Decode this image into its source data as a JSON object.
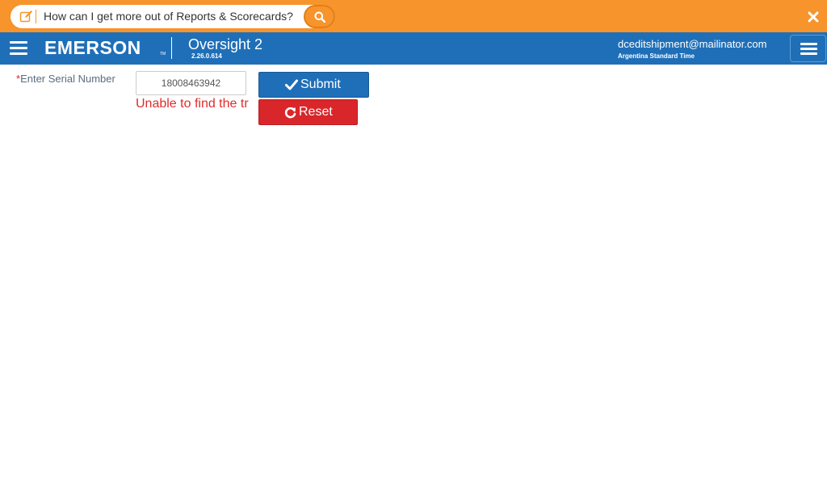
{
  "help_bar": {
    "search_text": "How can I get more out of Reports & Scorecards?",
    "accent_color": "#f7942b",
    "icons": [
      "edit-icon",
      "search-icon",
      "close-icon"
    ]
  },
  "navbar": {
    "brand": "EMERSON",
    "brand_mark": "TM",
    "app_title": "Oversight 2",
    "app_version": "2.26.0.614",
    "user_email": "dceditshipment@mailinator.com",
    "user_timezone": "Argentina Standard Time",
    "background_color": "#1f6fb8",
    "icons": [
      "hamburger-menu-icon",
      "hamburger-menu-icon"
    ]
  },
  "form": {
    "required_marker": "*",
    "serial_label": "Enter Serial Number",
    "serial_value": "18008463942",
    "error_message": "Unable to find the tr",
    "error_color": "#e02b2b",
    "submit_label": "Submit",
    "reset_label": "Reset",
    "submit_icon": "check-icon",
    "reset_icon": "refresh-icon"
  }
}
